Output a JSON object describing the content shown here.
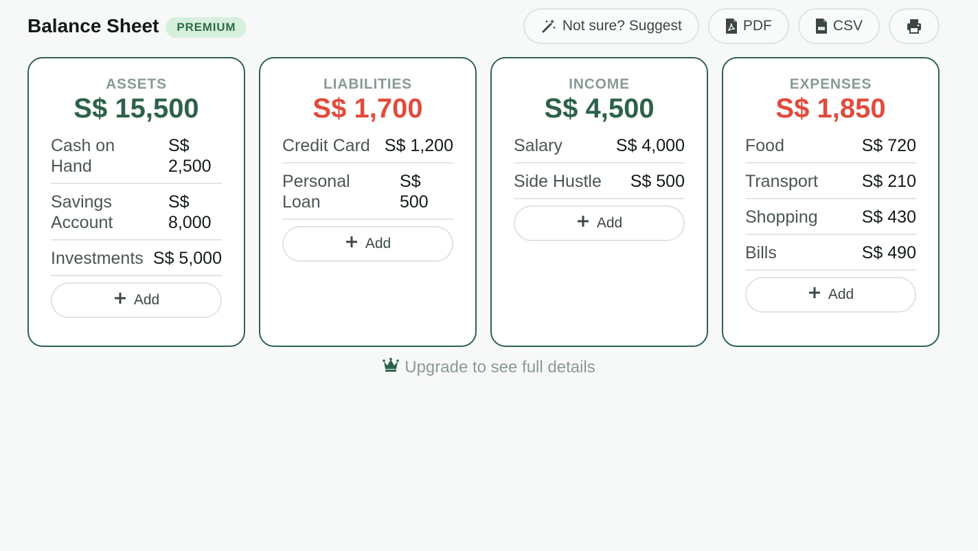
{
  "header": {
    "title": "Balance Sheet",
    "badge": "PREMIUM",
    "toolbar": {
      "suggest_label": "Not sure? Suggest",
      "pdf_label": "PDF",
      "csv_label": "CSV",
      "print_icon": "printer-icon"
    }
  },
  "colors": {
    "accent": "#2d6249",
    "negative": "#e24b3c",
    "muted": "#8a9a94",
    "badge_bg": "#d6f0dd"
  },
  "cards": {
    "assets": {
      "label": "ASSETS",
      "total": "S$ 15,500",
      "items": [
        {
          "name": "Cash on Hand",
          "value": "S$ 2,500"
        },
        {
          "name": "Savings Account",
          "value": "S$ 8,000"
        },
        {
          "name": "Investments",
          "value": "S$ 5,000"
        }
      ],
      "add_label": "Add"
    },
    "liabilities": {
      "label": "LIABILITIES",
      "total": "S$ 1,700",
      "items": [
        {
          "name": "Credit Card",
          "value": "S$ 1,200"
        },
        {
          "name": "Personal Loan",
          "value": "S$ 500"
        }
      ],
      "add_label": "Add"
    },
    "income": {
      "label": "INCOME",
      "total": "S$ 4,500",
      "items": [
        {
          "name": "Salary",
          "value": "S$ 4,000"
        },
        {
          "name": "Side Hustle",
          "value": "S$ 500"
        }
      ],
      "add_label": "Add"
    },
    "expenses": {
      "label": "EXPENSES",
      "total": "S$ 1,850",
      "items": [
        {
          "name": "Food",
          "value": "S$ 720"
        },
        {
          "name": "Transport",
          "value": "S$ 210"
        },
        {
          "name": "Shopping",
          "value": "S$ 430"
        },
        {
          "name": "Bills",
          "value": "S$ 490"
        }
      ],
      "add_label": "Add"
    }
  },
  "upgrade_text": "Upgrade to see full details"
}
